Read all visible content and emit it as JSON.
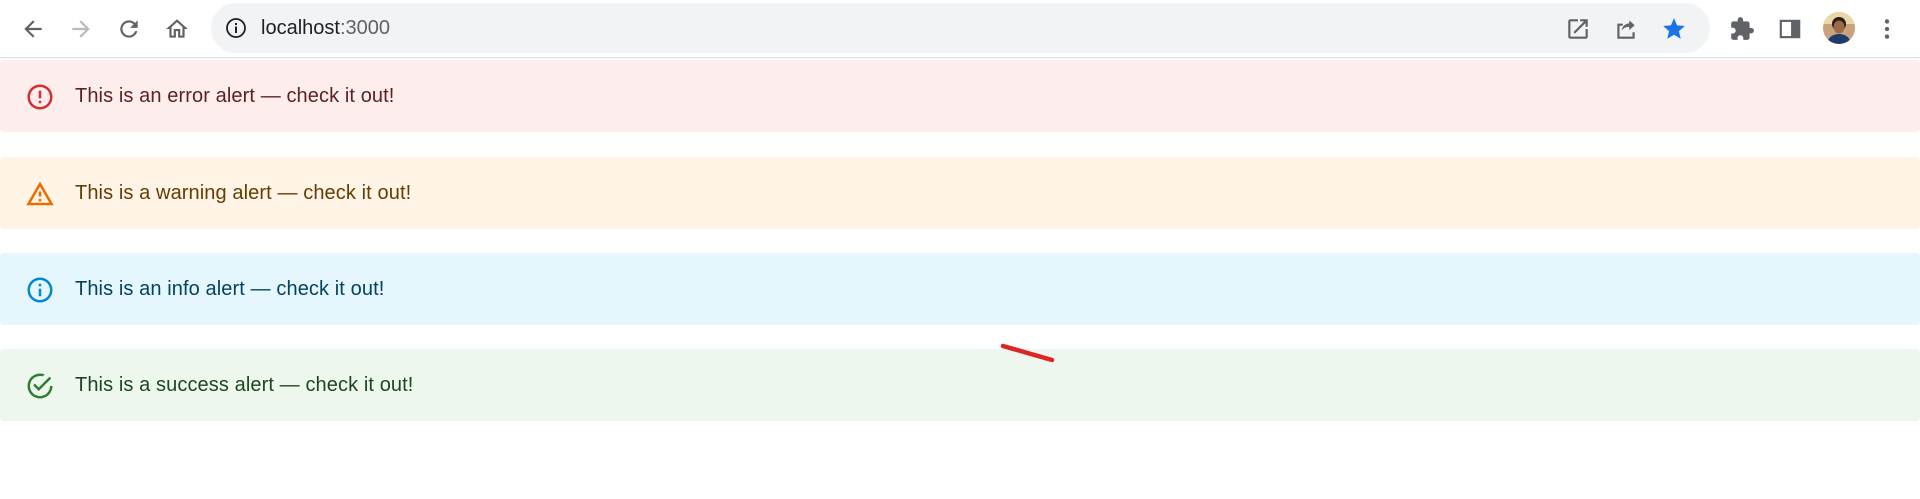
{
  "browser": {
    "url_host": "localhost",
    "url_port": ":3000",
    "icons": {
      "back": "arrow-back-icon",
      "forward": "arrow-forward-icon",
      "reload": "reload-icon",
      "home": "home-icon",
      "site_info": "info-icon",
      "open_external": "open-in-new-icon",
      "share": "share-icon",
      "bookmark": "star-icon",
      "extensions": "puzzle-piece-icon",
      "side_panel": "side-panel-icon",
      "menu": "vertical-dots-icon"
    },
    "colors": {
      "bookmark_star": "#1a73e8",
      "icon": "#5f6368"
    }
  },
  "alerts": [
    {
      "severity": "error",
      "icon": "error-outline-icon",
      "text": "This is an error alert — check it out!",
      "bg": "#fdeded",
      "fg": "#5f2120",
      "icon_color": "#d32f2f"
    },
    {
      "severity": "warning",
      "icon": "warning-triangle-icon",
      "text": "This is a warning alert — check it out!",
      "bg": "#fff4e5",
      "fg": "#663c00",
      "icon_color": "#ed6c02"
    },
    {
      "severity": "info",
      "icon": "info-outline-icon",
      "text": "This is an info alert — check it out!",
      "bg": "#e5f6fd",
      "fg": "#014361",
      "icon_color": "#0288d1"
    },
    {
      "severity": "success",
      "icon": "check-circle-outline-icon",
      "text": "This is a success alert — check it out!",
      "bg": "#edf7ed",
      "fg": "#1e4620",
      "icon_color": "#2e7d32"
    }
  ]
}
